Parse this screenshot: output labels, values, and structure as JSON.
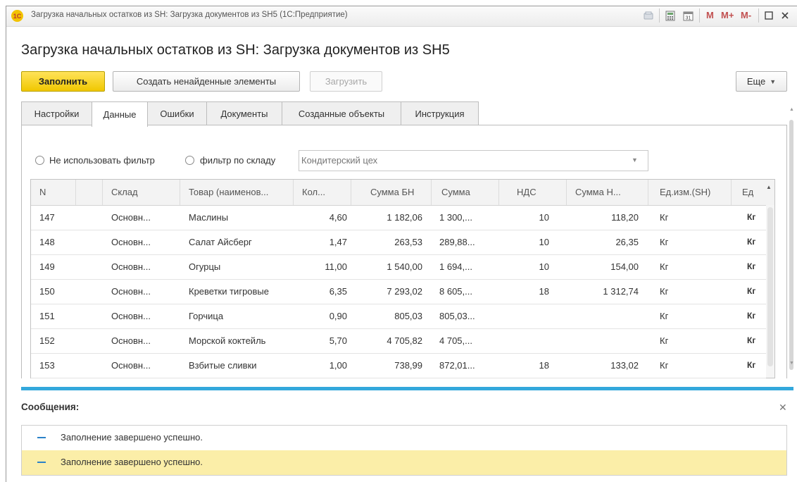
{
  "window": {
    "logo_text": "1С",
    "title": "Загрузка начальных остатков из SH: Загрузка документов из SH5  (1С:Предприятие)",
    "mem_buttons": [
      "M",
      "M+",
      "M-"
    ],
    "icons": [
      "link-icon",
      "calculator-icon",
      "calendar-icon",
      "maximize-icon",
      "close-icon"
    ]
  },
  "page": {
    "title": "Загрузка начальных остатков из SH: Загрузка документов из SH5"
  },
  "toolbar": {
    "fill": "Заполнить",
    "create_missing": "Создать ненайденные элементы",
    "load": "Загрузить",
    "more": "Еще"
  },
  "tabs": [
    "Настройки",
    "Данные",
    "Ошибки",
    "Документы",
    "Созданные объекты",
    "Инструкция"
  ],
  "active_tab": "Данные",
  "filter": {
    "no_filter_label": "Не использовать фильтр",
    "warehouse_filter_label": "фильтр по складу",
    "warehouse_value": "Кондитерский цех"
  },
  "table": {
    "columns": [
      "N",
      "",
      "Склад",
      "Товар (наименов...",
      "Кол...",
      "Сумма БН",
      "Сумма",
      "НДС",
      "Сумма Н...",
      "Ед.изм.(SH)",
      "Ед"
    ],
    "rows": [
      [
        "147",
        "",
        "Основн...",
        "Маслины",
        "4,60",
        "1 182,06",
        "1 300,...",
        "10",
        "118,20",
        "Кг",
        "Кг"
      ],
      [
        "148",
        "",
        "Основн...",
        "Салат Айсберг",
        "1,47",
        "263,53",
        "289,88...",
        "10",
        "26,35",
        "Кг",
        "Кг"
      ],
      [
        "149",
        "",
        "Основн...",
        "Огурцы",
        "11,00",
        "1 540,00",
        "1 694,...",
        "10",
        "154,00",
        "Кг",
        "Кг"
      ],
      [
        "150",
        "",
        "Основн...",
        "Креветки тигровые",
        "6,35",
        "7 293,02",
        "8 605,...",
        "18",
        "1 312,74",
        "Кг",
        "Кг"
      ],
      [
        "151",
        "",
        "Основн...",
        "Горчица",
        "0,90",
        "805,03",
        "805,03...",
        "",
        "",
        "Кг",
        "Кг"
      ],
      [
        "152",
        "",
        "Основн...",
        "Морской коктейль",
        "5,70",
        "4 705,82",
        "4 705,...",
        "",
        "",
        "Кг",
        "Кг"
      ],
      [
        "153",
        "",
        "Основн...",
        "Взбитые сливки",
        "1,00",
        "738,99",
        "872,01...",
        "18",
        "133,02",
        "Кг",
        "Кг"
      ]
    ]
  },
  "messages": {
    "title": "Сообщения:",
    "items": [
      "Заполнение завершено успешно.",
      "Заполнение завершено успешно."
    ]
  },
  "colors": {
    "primary_button": "#f0c700",
    "accent_bar": "#33a8dc",
    "selected_message": "#fbeea8"
  }
}
